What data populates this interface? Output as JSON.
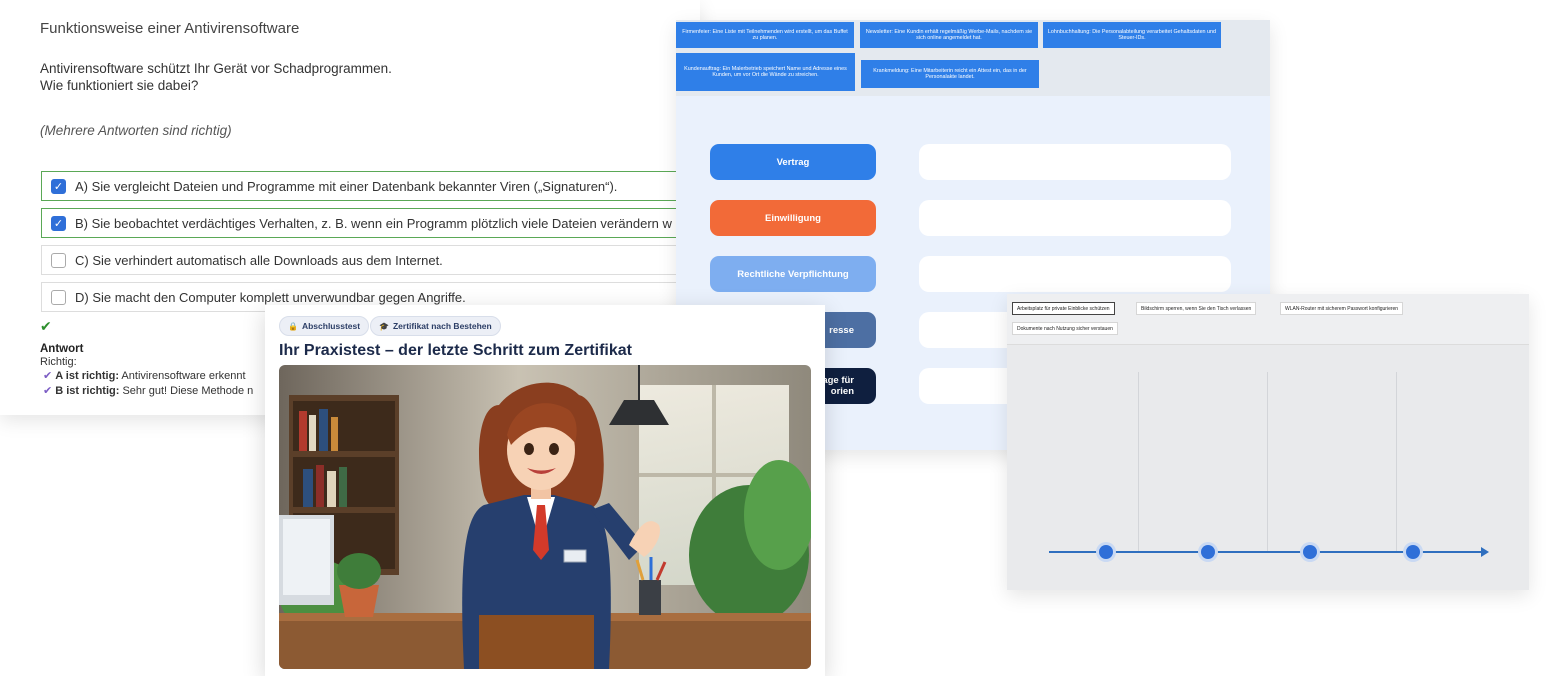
{
  "quiz": {
    "title": "Funktionsweise einer Antivirensoftware",
    "question_line1": "Antivirensoftware schützt Ihr Gerät vor Schadprogrammen.",
    "question_line2": "Wie funktioniert sie dabei?",
    "hint": "(Mehrere Antworten sind richtig)",
    "options": [
      {
        "label": "A) Sie vergleicht Dateien und Programme mit einer Datenbank bekannter Viren („Signaturen“).",
        "checked": true
      },
      {
        "label": "B) Sie beobachtet verdächtiges Verhalten, z. B. wenn ein Programm plötzlich viele Dateien verändern w",
        "checked": true
      },
      {
        "label": "C) Sie verhindert automatisch alle Downloads aus dem Internet.",
        "checked": false
      },
      {
        "label": "D) Sie macht den Computer komplett unverwundbar gegen Angriffe.",
        "checked": false
      }
    ],
    "answer_heading": "Antwort",
    "answer_sub": "Richtig:",
    "answers": [
      {
        "bold": "A ist richtig:",
        "text": " Antivirensoftware erkennt"
      },
      {
        "bold": "B ist richtig:",
        "text": " Sehr gut! Diese Methode n"
      }
    ]
  },
  "legal": {
    "chips": [
      "Firmenfeier: Eine Liste mit Teilnehmenden wird erstellt, um das Buffet zu planen.",
      "Newsletter: Eine Kundin erhält regelmäßig Werbe-Mails, nachdem sie sich online angemeldet hat.",
      "Lohnbuchhaltung: Die Personalabteilung verarbeitet Gehaltsdaten und Steuer-IDs.",
      "Kundenauftrag: Ein Malerbetrieb speichert Name und Adresse eines Kunden, um vor Ort die Wände zu streichen.",
      "Krankmeldung: Eine Mitarbeiterin reicht ein Attest ein, das in der Personalakte landet."
    ],
    "bases": [
      {
        "label": "Vertrag",
        "color": "#2f7fe8"
      },
      {
        "label": "Einwilligung",
        "color": "#f26a38"
      },
      {
        "label": "Rechtliche Verpflichtung",
        "color": "#7eaef0"
      },
      {
        "label": "resse",
        "color": "#4d6fa3"
      },
      {
        "label": "age für\norien",
        "color": "#0f1f3f"
      }
    ]
  },
  "timeline": {
    "chips": [
      "Arbeitsplatz für private Einblicke schützen",
      "Bildschirm sperren, wenn Sie den Tisch verlassen",
      "WLAN-Router mit sicherem Passwort konfigurieren",
      "Dokumente nach Nutzung sicher verstauen"
    ]
  },
  "card": {
    "badge1": "Abschlusstest",
    "badge2": "Zertifikat nach Bestehen",
    "title": "Ihr Praxistest – der letzte Schritt zum Zertifikat"
  },
  "colors": {
    "accent_blue": "#2f7fe8",
    "consent_orange": "#f26a38",
    "correct_green": "#5aa856",
    "navy": "#1c2a4a"
  }
}
